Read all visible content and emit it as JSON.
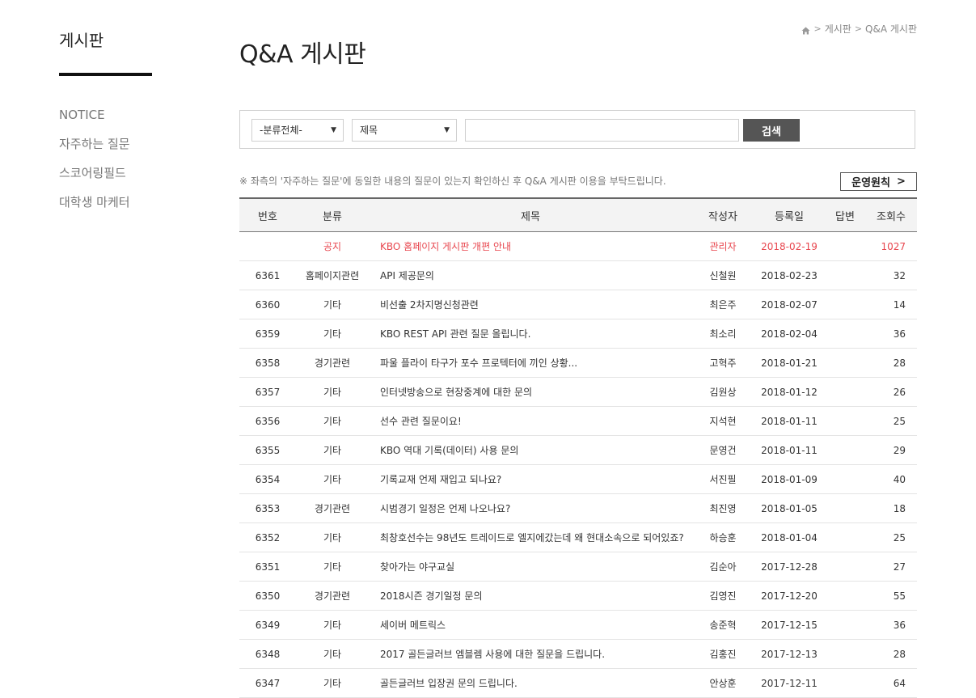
{
  "sidebar": {
    "title": "게시판",
    "items": [
      {
        "label": "NOTICE"
      },
      {
        "label": "자주하는 질문"
      },
      {
        "label": "스코어링필드"
      },
      {
        "label": "대학생 마케터"
      }
    ]
  },
  "breadcrumb": {
    "home_icon": "home-icon",
    "items": [
      "게시판",
      "Q&A 게시판"
    ],
    "separator": ">"
  },
  "page_title": "Q&A 게시판",
  "search": {
    "category_value": "-분류전체-",
    "field_value": "제목",
    "input_value": "",
    "button_label": "검색"
  },
  "notice_text": "※ 좌측의 '자주하는 질문'에 동일한 내용의 질문이 있는지 확인하신 후 Q&A 게시판 이용을 부탁드립니다.",
  "rules_button": "운영원칙",
  "table": {
    "headers": {
      "no": "번호",
      "category": "분류",
      "title": "제목",
      "author": "작성자",
      "date": "등록일",
      "answer": "답변",
      "views": "조회수"
    },
    "rows": [
      {
        "no": "",
        "category": "공지",
        "title": "KBO 홈페이지 게시판 개편 안내",
        "author": "관리자",
        "date": "2018-02-19",
        "answer": "",
        "views": "1027",
        "notice": true
      },
      {
        "no": "6361",
        "category": "홈페이지관련",
        "title": "API 제공문의",
        "author": "신철원",
        "date": "2018-02-23",
        "answer": "",
        "views": "32"
      },
      {
        "no": "6360",
        "category": "기타",
        "title": "비선출 2차지명신청관련",
        "author": "최은주",
        "date": "2018-02-07",
        "answer": "",
        "views": "14"
      },
      {
        "no": "6359",
        "category": "기타",
        "title": "KBO REST API 관련 질문 올립니다.",
        "author": "최소리",
        "date": "2018-02-04",
        "answer": "",
        "views": "36"
      },
      {
        "no": "6358",
        "category": "경기관련",
        "title": "파울 플라이 타구가 포수 프로텍터에 끼인 상황...",
        "author": "고혁주",
        "date": "2018-01-21",
        "answer": "",
        "views": "28"
      },
      {
        "no": "6357",
        "category": "기타",
        "title": "인터넷방송으로 현장중계에 대한 문의",
        "author": "김원상",
        "date": "2018-01-12",
        "answer": "",
        "views": "26"
      },
      {
        "no": "6356",
        "category": "기타",
        "title": "선수 관련 질문이요!",
        "author": "지석현",
        "date": "2018-01-11",
        "answer": "",
        "views": "25"
      },
      {
        "no": "6355",
        "category": "기타",
        "title": "KBO 역대 기록(데이터) 사용 문의",
        "author": "문영건",
        "date": "2018-01-11",
        "answer": "",
        "views": "29"
      },
      {
        "no": "6354",
        "category": "기타",
        "title": "기록교재 언제 재입고 되나요?",
        "author": "서진필",
        "date": "2018-01-09",
        "answer": "",
        "views": "40"
      },
      {
        "no": "6353",
        "category": "경기관련",
        "title": "시범경기 일정은 언제 나오나요?",
        "author": "최진영",
        "date": "2018-01-05",
        "answer": "",
        "views": "18"
      },
      {
        "no": "6352",
        "category": "기타",
        "title": "최창호선수는 98년도 트레이드로 엘지에갔는데 왜 현대소속으로 되어있죠?",
        "author": "하승훈",
        "date": "2018-01-04",
        "answer": "",
        "views": "25"
      },
      {
        "no": "6351",
        "category": "기타",
        "title": "찾아가는 야구교실",
        "author": "김순아",
        "date": "2017-12-28",
        "answer": "",
        "views": "27"
      },
      {
        "no": "6350",
        "category": "경기관련",
        "title": "2018시즌 경기일정 문의",
        "author": "김영진",
        "date": "2017-12-20",
        "answer": "",
        "views": "55"
      },
      {
        "no": "6349",
        "category": "기타",
        "title": "세이버 메트릭스",
        "author": "송준혁",
        "date": "2017-12-15",
        "answer": "",
        "views": "36"
      },
      {
        "no": "6348",
        "category": "기타",
        "title": "2017 골든글러브 엠블렘 사용에 대한 질문을 드립니다.",
        "author": "김홍진",
        "date": "2017-12-13",
        "answer": "",
        "views": "28"
      },
      {
        "no": "6347",
        "category": "기타",
        "title": "골든글러브 입장권 문의 드립니다.",
        "author": "안상훈",
        "date": "2017-12-11",
        "answer": "",
        "views": "64"
      }
    ]
  },
  "colors": {
    "notice_red": "#e8474f",
    "search_button": "#555555",
    "header_bg": "#f3f3f3"
  }
}
